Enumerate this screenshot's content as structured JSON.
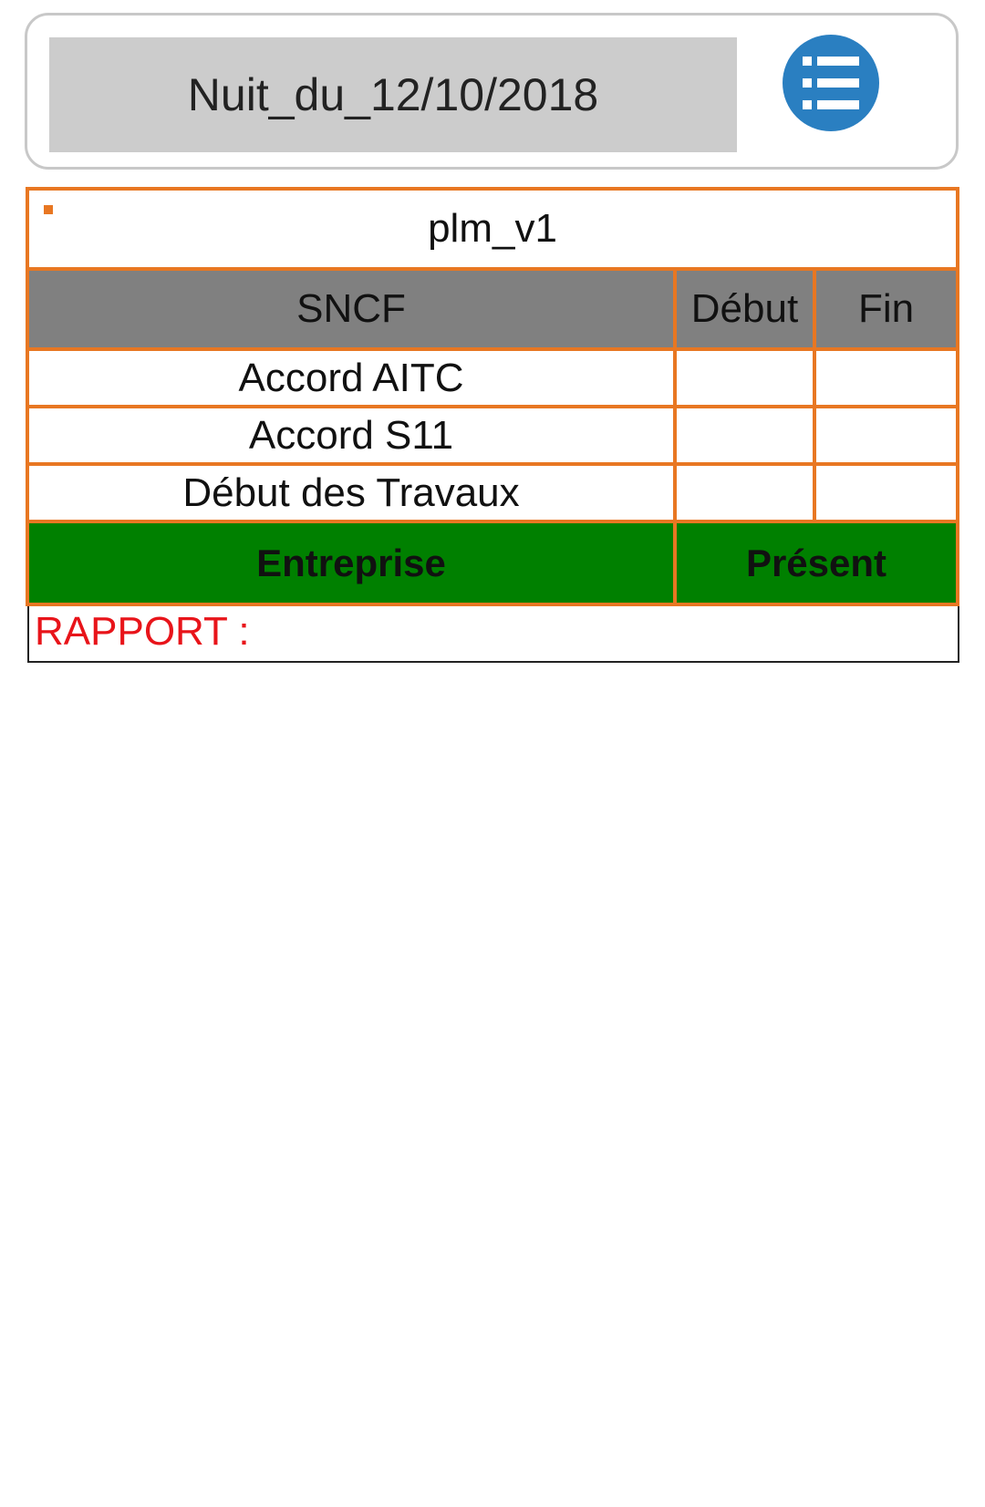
{
  "header": {
    "title": "Nuit_du_12/10/2018",
    "menu_icon": "list-icon",
    "menu_color": "#2a7fc1"
  },
  "sheet": {
    "name": "plm_v1",
    "columns": [
      "SNCF",
      "Début",
      "Fin"
    ],
    "rows": [
      {
        "label": "Accord AITC",
        "debut": "",
        "fin": ""
      },
      {
        "label": "Accord S11",
        "debut": "",
        "fin": ""
      },
      {
        "label": "Début des Travaux",
        "debut": "",
        "fin": ""
      }
    ],
    "footer": {
      "company": "Entreprise",
      "present": "Présent"
    }
  },
  "rapport": {
    "label": "RAPPORT :"
  },
  "colors": {
    "accent_border": "#e87722",
    "header_gray": "#808080",
    "footer_green": "#008000",
    "rapport_red": "#e8141a"
  }
}
